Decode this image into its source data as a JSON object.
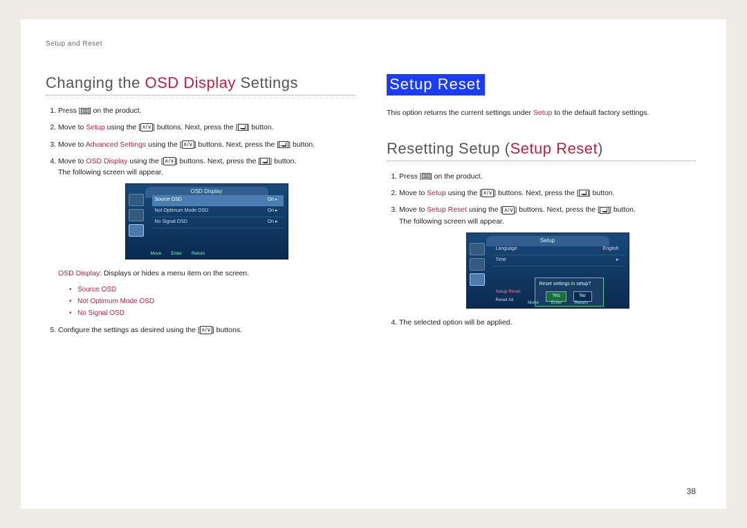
{
  "section_label": "Setup and Reset",
  "page_number": "38",
  "left": {
    "heading_pre": "Changing the ",
    "heading_accent": "OSD Display",
    "heading_post": " Settings",
    "steps": {
      "s1_a": "Press [",
      "s1_b": "] on the product.",
      "s2_a": "Move to ",
      "s2_accent": "Setup",
      "s2_b": " using the [",
      "s2_c": "] buttons. Next, press the [",
      "s2_d": "] button.",
      "s3_a": "Move to ",
      "s3_accent": "Advanced Settings",
      "s3_b": " using the [",
      "s3_c": "] buttons. Next, press the [",
      "s3_d": "] button.",
      "s4_a": "Move to ",
      "s4_accent": "OSD Display",
      "s4_b": " using the [",
      "s4_c": "] buttons. Next, press the [",
      "s4_d": "] button.",
      "s4_e": "The following screen will appear.",
      "s5_a": "Configure the settings as desired using the [",
      "s5_b": "] buttons."
    },
    "osd": {
      "title": "OSD Display",
      "rows": [
        {
          "label": "Source OSD",
          "value": "On"
        },
        {
          "label": "Not Optimum Mode OSD",
          "value": "On"
        },
        {
          "label": "No Signal OSD",
          "value": "On"
        }
      ],
      "footer": [
        "Move",
        "Enter",
        "Return"
      ]
    },
    "desc_accent": "OSD Display",
    "desc_rest": ": Displays or hides a menu item on the screen.",
    "bullets": [
      "Source OSD",
      "Not Optimum Mode OSD",
      "No Signal OSD"
    ]
  },
  "right": {
    "banner": "Setup Reset",
    "intro_a": "This option returns the current settings under ",
    "intro_accent": "Setup",
    "intro_b": " to the default factory settings.",
    "heading_pre": "Resetting Setup (",
    "heading_accent": "Setup Reset",
    "heading_post": ")",
    "steps": {
      "s1_a": "Press [",
      "s1_b": "] on the product.",
      "s2_a": "Move to ",
      "s2_accent": "Setup",
      "s2_b": " using the [",
      "s2_c": "] buttons. Next, press the [",
      "s2_d": "] button.",
      "s3_a": "Move to ",
      "s3_accent": "Setup Reset",
      "s3_b": " using the [",
      "s3_c": "] buttons. Next, press the [",
      "s3_d": "] button.",
      "s3_e": "The following screen will appear.",
      "s4": "The selected option will be applied."
    },
    "osd": {
      "title": "Setup",
      "row1_label": "Language",
      "row1_value": "English",
      "row2_label": "Time",
      "dialog": "Reset settings in setup?",
      "yes": "Yes",
      "no": "No",
      "sub1": "Setup Reset",
      "sub2": "Reset All",
      "footer": [
        "Move",
        "Enter",
        "Return"
      ]
    }
  }
}
